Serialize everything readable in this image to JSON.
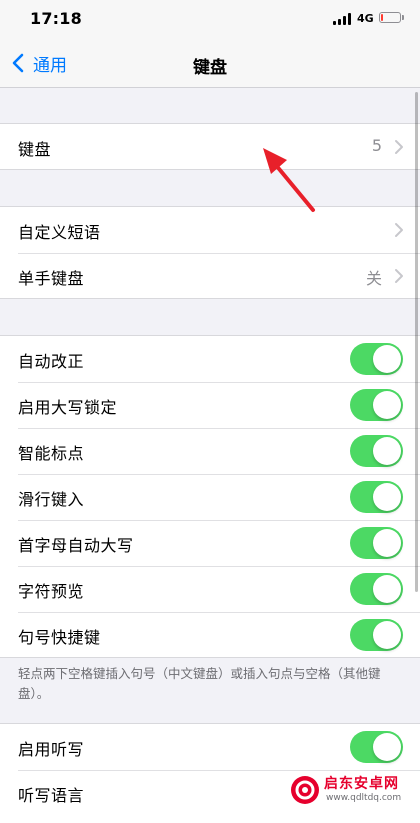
{
  "status_bar": {
    "time": "17:18",
    "network": "4G",
    "battery_level": 0.1,
    "signal_icon": "signal-bars-icon",
    "battery_icon": "battery-low-icon"
  },
  "nav": {
    "back_label": "通用",
    "back_icon": "chevron-left-icon",
    "title": "键盘"
  },
  "groups": {
    "keyboards": {
      "label": "键盘",
      "value": "5"
    },
    "shortcuts": {
      "text_replacement": "自定义短语",
      "one_handed": "单手键盘",
      "one_handed_value": "关"
    },
    "toggles": [
      {
        "label": "自动改正",
        "on": true
      },
      {
        "label": "启用大写锁定",
        "on": true
      },
      {
        "label": "智能标点",
        "on": true
      },
      {
        "label": "滑行键入",
        "on": true
      },
      {
        "label": "首字母自动大写",
        "on": true
      },
      {
        "label": "字符预览",
        "on": true
      },
      {
        "label": "句号快捷键",
        "on": true
      }
    ],
    "footer_note": "轻点两下空格键插入句号（中文键盘）或插入句点与空格（其他键盘）。",
    "dictation": {
      "enable_dictation": "启用听写",
      "enable_dictation_on": true,
      "dictation_language": "听写语言"
    }
  },
  "colors": {
    "accent": "#007aff",
    "toggle_on": "#4cd964",
    "annotation_arrow": "#e8202a"
  },
  "watermark": {
    "name": "启东安卓网",
    "url": "www.qdltdq.com"
  }
}
